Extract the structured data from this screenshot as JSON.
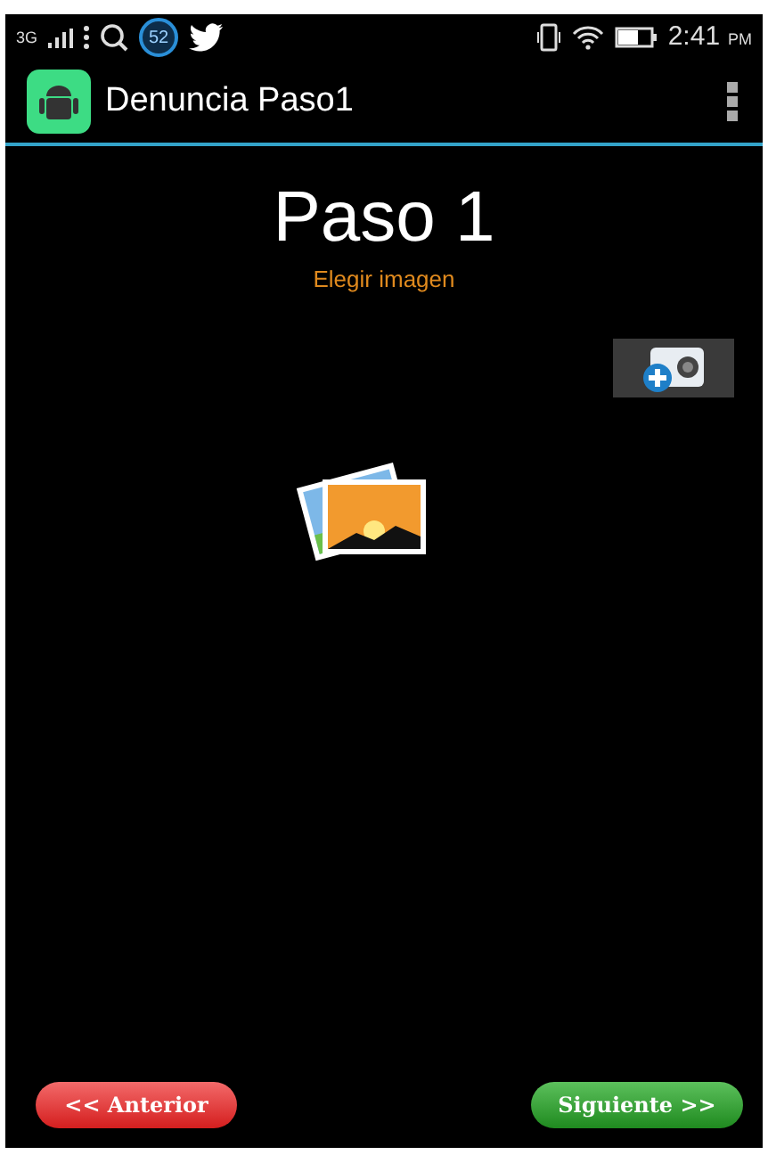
{
  "status_bar": {
    "network": "3G",
    "notification_count": "52",
    "time": "2:41",
    "time_suffix": "PM"
  },
  "action_bar": {
    "title": "Denuncia Paso1"
  },
  "content": {
    "heading": "Paso 1",
    "subtitle": "Elegir imagen"
  },
  "buttons": [
    {
      "kind": "back",
      "label": "<< Anterior"
    },
    {
      "kind": "next",
      "label": "Siguiente >>"
    }
  ]
}
